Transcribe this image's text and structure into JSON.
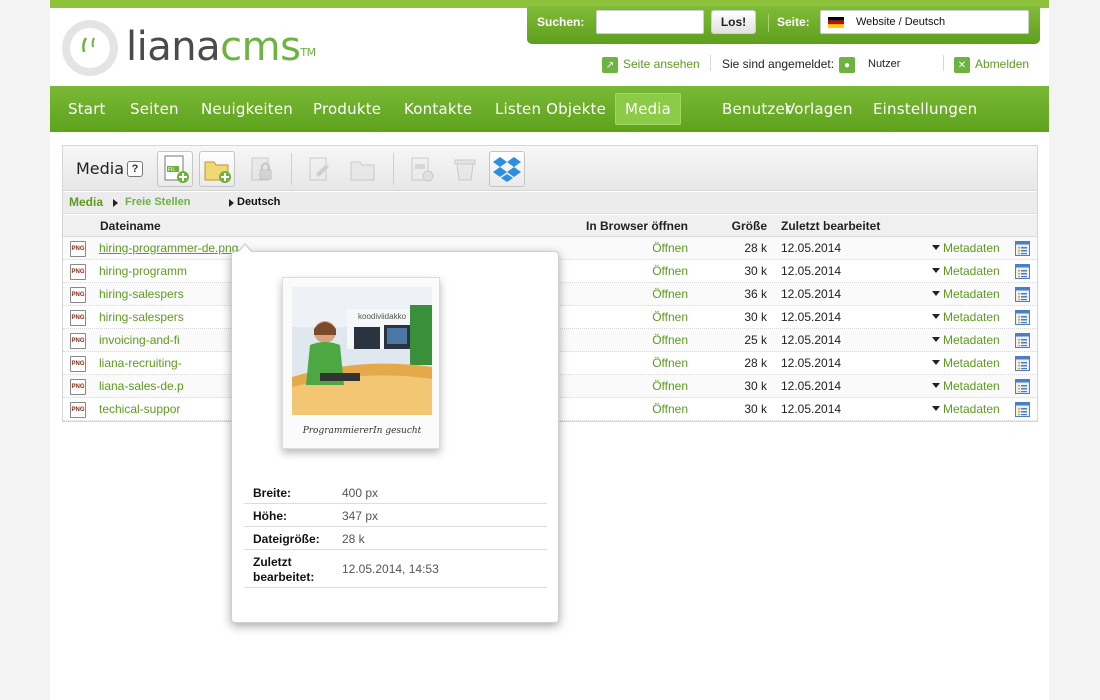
{
  "logo": {
    "liana": "liana",
    "cms": "cms",
    "tm": "TM"
  },
  "search": {
    "label": "Suchen:",
    "value": "",
    "button": "Los!"
  },
  "site": {
    "label": "Seite:",
    "selected": "Website / Deutsch",
    "flag": "german-flag-icon"
  },
  "userbar": {
    "view_site": "Seite ansehen",
    "logged_in_label": "Sie sind angemeldet:",
    "user": "Nutzer",
    "logout": "Abmelden"
  },
  "nav": {
    "items": [
      "Start",
      "Seiten",
      "Neuigkeiten",
      "Produkte",
      "Kontakte",
      "Listen Objekte",
      "Media",
      "Benutzer",
      "Vorlagen",
      "Einstellungen"
    ],
    "active": "Media"
  },
  "toolbar": {
    "title": "Media",
    "help": "?"
  },
  "breadcrumb": {
    "root": "Media",
    "folder": "Freie Stellen",
    "language": "Deutsch"
  },
  "table": {
    "headers": {
      "name": "Dateiname",
      "open": "In Browser öffnen",
      "size": "Größe",
      "modified": "Zuletzt bearbeitet"
    },
    "type_badge": "PNG",
    "open_label": "Öffnen",
    "meta_label": "Metadaten",
    "rows": [
      {
        "name": "hiring-programmer-de.png",
        "size": "28 k",
        "date": "12.05.2014"
      },
      {
        "name": "hiring-programm",
        "size": "30 k",
        "date": "12.05.2014"
      },
      {
        "name": "hiring-salespers",
        "size": "36 k",
        "date": "12.05.2014"
      },
      {
        "name": "hiring-salespers",
        "size": "30 k",
        "date": "12.05.2014"
      },
      {
        "name": "invoicing-and-fi",
        "size": "25 k",
        "date": "12.05.2014"
      },
      {
        "name": "liana-recruiting-",
        "size": "28 k",
        "date": "12.05.2014"
      },
      {
        "name": "liana-sales-de.p",
        "size": "30 k",
        "date": "12.05.2014"
      },
      {
        "name": "techical-suppor",
        "size": "30 k",
        "date": "12.05.2014"
      }
    ]
  },
  "popup": {
    "caption": "ProgrammiererIn gesucht",
    "photo_sign": "koodiviidakko",
    "props": [
      {
        "key": "Breite:",
        "value": "400 px"
      },
      {
        "key": "Höhe:",
        "value": "347 px"
      },
      {
        "key": "Dateigröße:",
        "value": "28 k"
      },
      {
        "key": "Zuletzt bearbeitet:",
        "value": "12.05.2014, 14:53"
      }
    ]
  },
  "colors": {
    "brand_green": "#6cb33f",
    "link_green": "#5c9c1e",
    "nav_active": "#8ccb48"
  }
}
